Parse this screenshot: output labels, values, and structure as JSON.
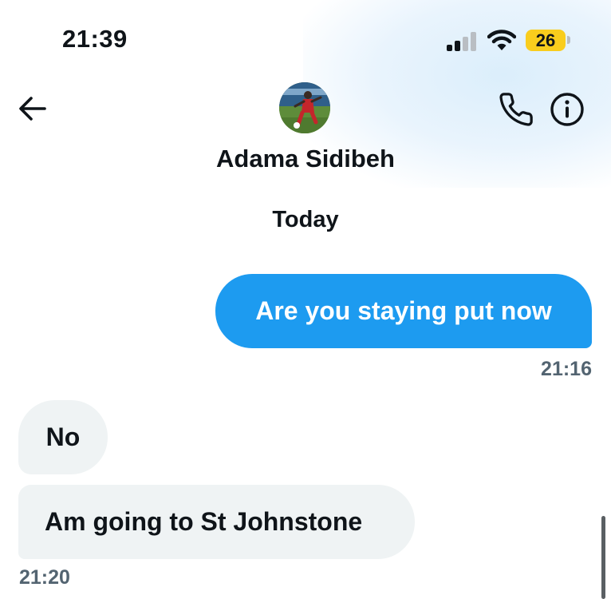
{
  "status_bar": {
    "time": "21:39",
    "battery_level": "26",
    "signal_bars_filled": 2,
    "signal_bars_total": 4
  },
  "header": {
    "contact_name": "Adama Sidibeh",
    "back_icon": "arrow-left-icon",
    "call_icon": "phone-icon",
    "info_icon": "info-icon"
  },
  "conversation": {
    "date_divider": "Today",
    "messages": [
      {
        "direction": "outgoing",
        "text": "Are you staying put now",
        "time": "21:16"
      },
      {
        "direction": "incoming",
        "text": "No"
      },
      {
        "direction": "incoming",
        "text": "Am going to St Johnstone",
        "time": "21:20"
      }
    ]
  },
  "colors": {
    "accent": "#1d9bf0",
    "incoming_bubble": "#eff3f4",
    "timestamp": "#536471",
    "battery": "#f9cd1d"
  }
}
